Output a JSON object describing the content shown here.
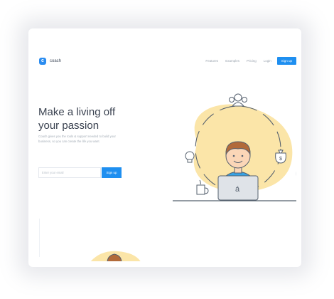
{
  "brand": {
    "name": "coach",
    "logo_letter": "c",
    "color": "#2a8cf0"
  },
  "nav": {
    "links": [
      "Features",
      "Examples",
      "Pricing",
      "Login"
    ],
    "signup_label": "Sign up"
  },
  "hero": {
    "title_line1": "Make a living off",
    "title_line2": "your passion",
    "subtitle": "Coach gives you the tools & support needed to build your business, so you can create the life you want.",
    "email_placeholder": "Enter your email",
    "signup_button": "Sign up"
  },
  "illustration": {
    "laptop_glyph": "á",
    "icons": [
      "people-icon",
      "lightbulb-icon",
      "money-bag-icon",
      "coffee-cup-icon"
    ]
  },
  "colors": {
    "accent": "#1f8ff0",
    "blob": "#fbe5a8",
    "shirt": "#36a3e6"
  }
}
